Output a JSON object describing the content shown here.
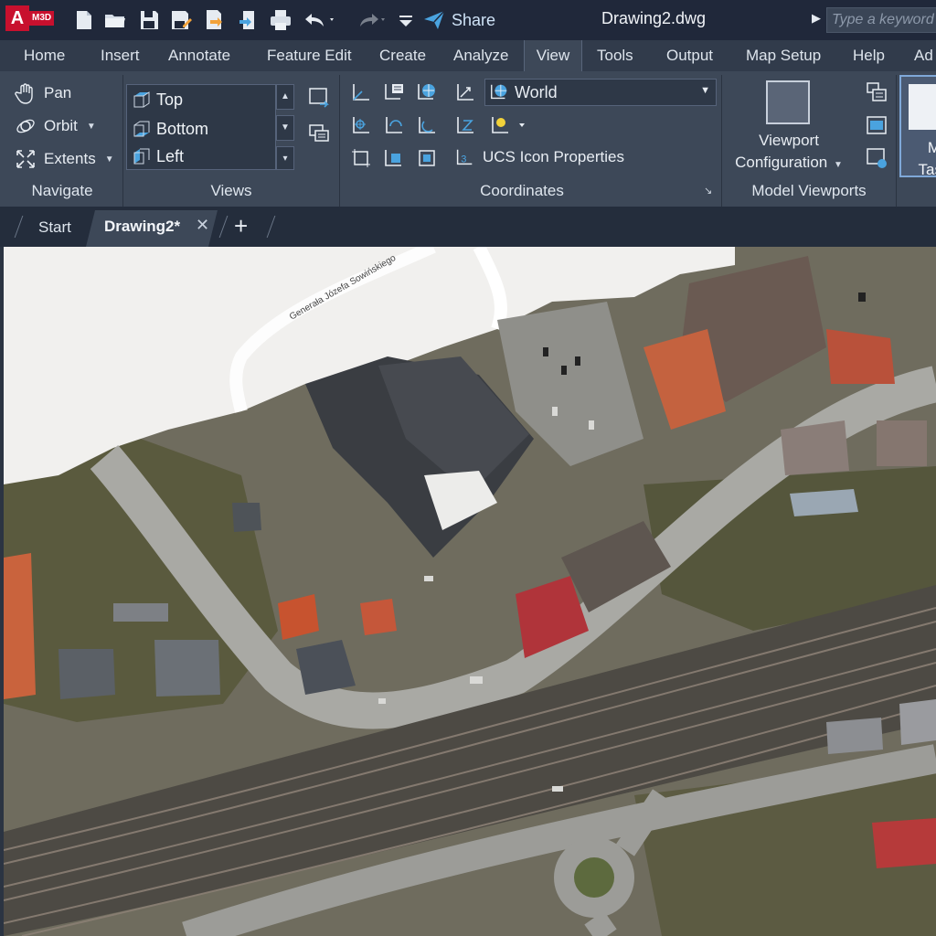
{
  "app": {
    "badge": "A",
    "product": "M3D"
  },
  "quick_access": {
    "share_label": "Share",
    "icons": [
      "new-icon",
      "open-icon",
      "save-icon",
      "save-as-icon",
      "import-icon",
      "export-icon",
      "print-icon",
      "undo-icon",
      "redo-icon",
      "customize-icon"
    ]
  },
  "document": {
    "title": "Drawing2.dwg"
  },
  "search": {
    "placeholder": "Type a keyword"
  },
  "ribbon_tabs": [
    "Home",
    "Insert",
    "Annotate",
    "Feature Edit",
    "Create",
    "Analyze",
    "View",
    "Tools",
    "Output",
    "Map Setup",
    "Help",
    "Ad"
  ],
  "active_tab": "View",
  "navigate": {
    "title": "Navigate",
    "pan": "Pan",
    "orbit": "Orbit",
    "extents": "Extents"
  },
  "views": {
    "title": "Views",
    "items": [
      "Top",
      "Bottom",
      "Left"
    ]
  },
  "coordinates": {
    "title": "Coordinates",
    "ucs_value": "World",
    "ucs_icon_properties": "UCS Icon Properties"
  },
  "viewports": {
    "title": "Model Viewports",
    "config_line1": "Viewport",
    "config_line2": "Configuration"
  },
  "model_task": {
    "line1": "M",
    "line2": "Task"
  },
  "file_tabs": {
    "start": "Start",
    "active": "Drawing2*"
  },
  "map": {
    "street_label": "Generała Józefa Sowińskiego"
  },
  "colors": {
    "accent": "#c8102e",
    "ribbon": "#3d4858",
    "titlebar": "#20283a",
    "share": "#4aa3df"
  }
}
